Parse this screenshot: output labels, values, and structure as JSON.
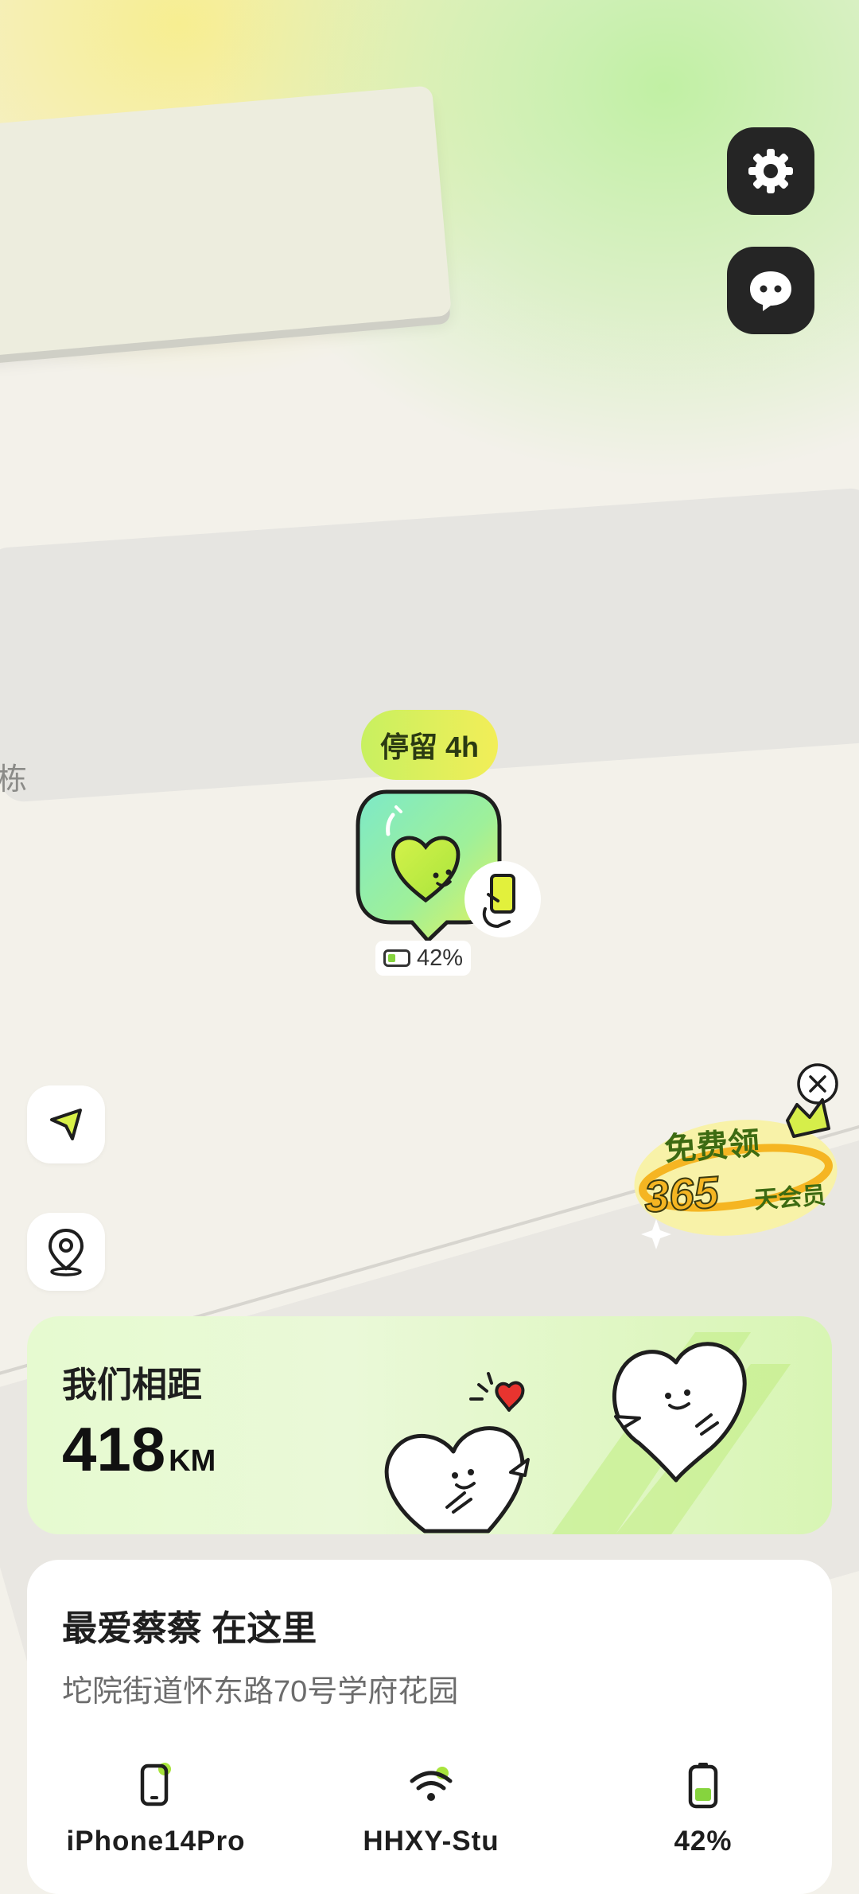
{
  "map": {
    "street_label": "栋"
  },
  "top_right_buttons": {
    "settings_icon": "gear-icon",
    "message_icon": "chat-bubble-icon"
  },
  "marker": {
    "stay_label": "停留 4h",
    "battery_percent": "42%",
    "battery_level": 0.42,
    "device_badge_icon": "hand-holding-phone-icon"
  },
  "left_buttons": {
    "locate_icon": "navigation-arrow-icon",
    "pin_icon": "location-pin-icon"
  },
  "promo": {
    "line1": "免费领",
    "number": "365",
    "line2": "天会员"
  },
  "distance_card": {
    "title": "我们相距",
    "value": "418",
    "unit": "KM"
  },
  "location_card": {
    "title": "最爱蔡蔡 在这里",
    "address": "坨院街道怀东路70号学府花园",
    "device": "iPhone14Pro",
    "wifi": "HHXY-Stu",
    "battery": "42%"
  },
  "colors": {
    "accent_green": "#b8ef5a",
    "accent_yellow": "#f2ee58",
    "dark_button": "#252525",
    "card_bg": "#ffffff"
  }
}
